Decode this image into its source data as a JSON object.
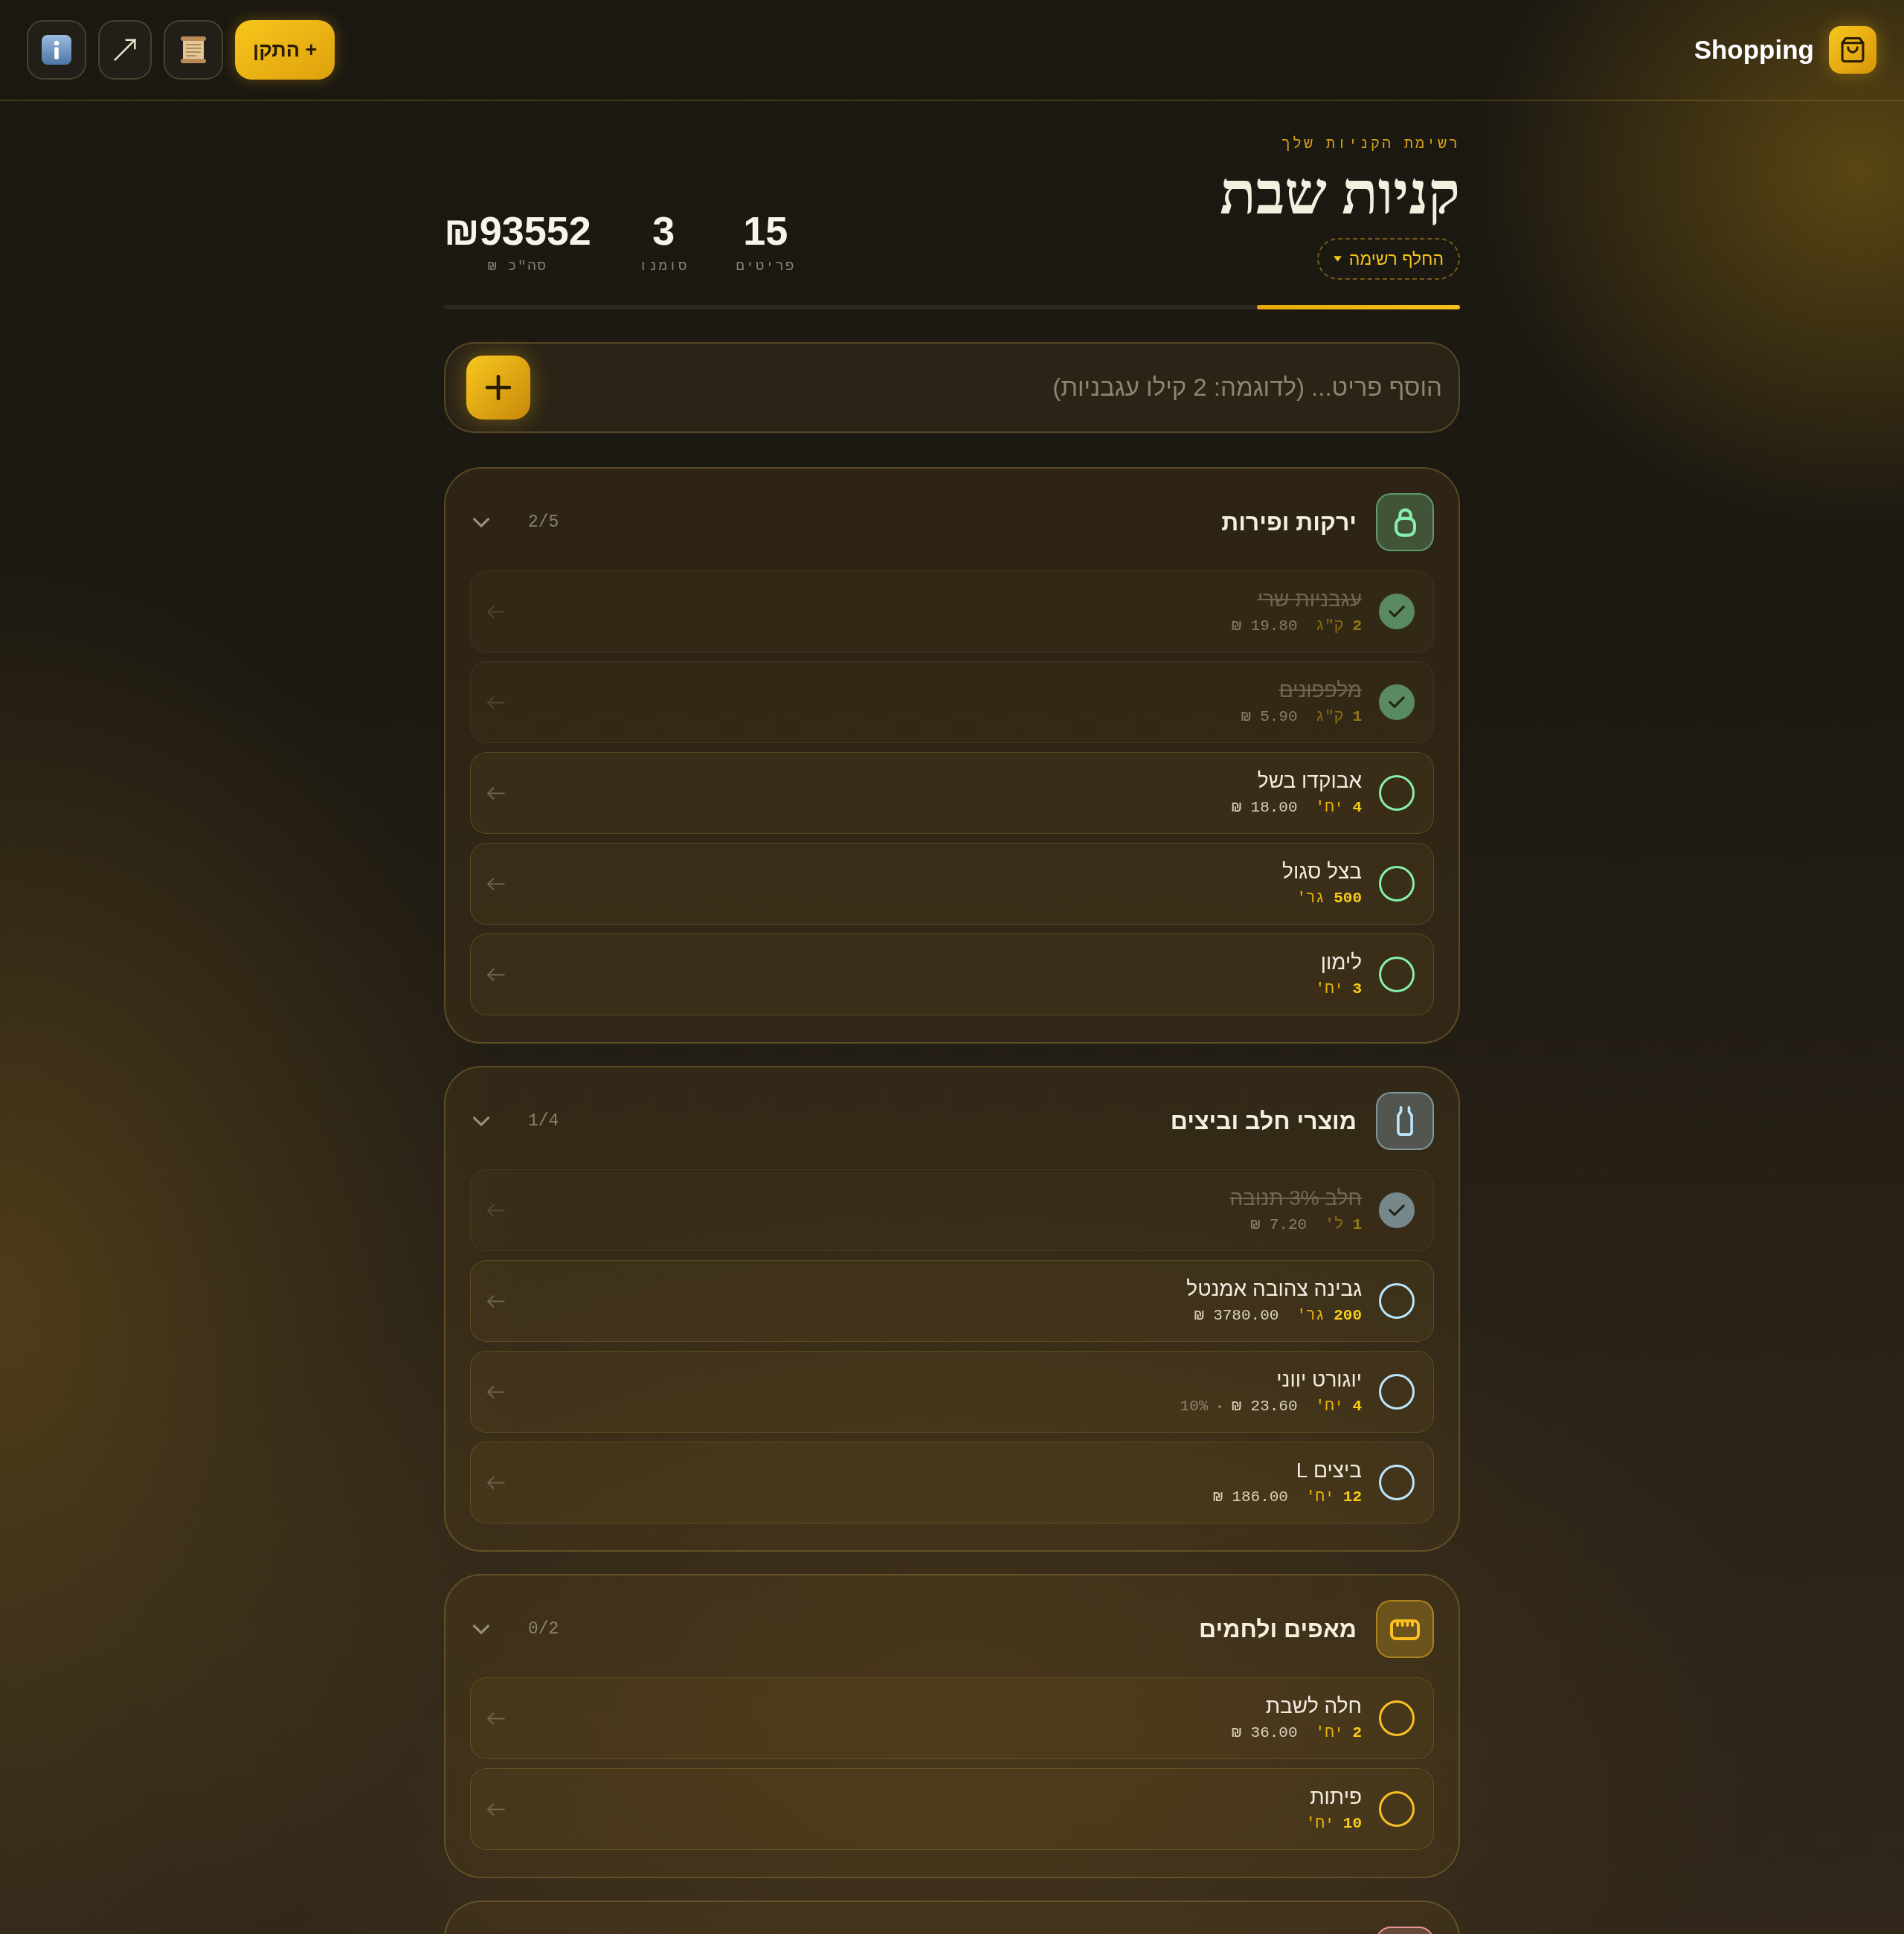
{
  "topbar": {
    "title": "Shopping",
    "install_button": "+ התקן"
  },
  "header": {
    "eyebrow": "רשימת הקניות שלך",
    "title": "קניות שבת",
    "switch_list": "החלף רשימה",
    "stats": [
      {
        "value": "15",
        "label": "פריטים"
      },
      {
        "value": "3",
        "label": "סומנו"
      },
      {
        "value": "₪93552",
        "label": "סה\"כ ₪"
      }
    ],
    "progress": {
      "level": 0.2
    }
  },
  "add_item": {
    "placeholder": "הוסף פריט... (לדוגמה: 2 קילו עגבניות)"
  },
  "categories": [
    {
      "kind": "produce",
      "name": "ירקות ופירות",
      "count": "2/5",
      "expanded": true,
      "color": "#86efac",
      "items": [
        {
          "name": "עגבניות שרי",
          "qty": "2",
          "unit": "ק\"ג",
          "price": "19.80 ₪",
          "checked": true
        },
        {
          "name": "מלפפונים",
          "qty": "1",
          "unit": "ק\"ג",
          "price": "5.90 ₪",
          "checked": true
        },
        {
          "name": "אבוקדו בשל",
          "qty": "4",
          "unit": "יח'",
          "price": "18.00 ₪",
          "checked": false
        },
        {
          "name": "בצל סגול",
          "qty": "500",
          "unit": "גר'",
          "checked": false
        },
        {
          "name": "לימון",
          "qty": "3",
          "unit": "יח'",
          "checked": false
        }
      ]
    },
    {
      "kind": "dairy",
      "name": "מוצרי חלב וביצים",
      "count": "1/4",
      "expanded": true,
      "color": "#bae6fd",
      "items": [
        {
          "name": "חלב 3% תנובה",
          "qty": "1",
          "unit": "ל'",
          "price": "7.20 ₪",
          "checked": true
        },
        {
          "name": "גבינה צהובה אמנטל",
          "qty": "200",
          "unit": "גר'",
          "price": "3780.00 ₪",
          "checked": false
        },
        {
          "name": "יוגורט יווני",
          "qty": "4",
          "unit": "יח'",
          "price": "23.60 ₪",
          "note": "10%",
          "checked": false
        },
        {
          "name": "ביצים L",
          "qty": "12",
          "unit": "יח'",
          "price": "186.00 ₪",
          "checked": false
        }
      ]
    },
    {
      "kind": "bakery",
      "name": "מאפים ולחמים",
      "count": "0/2",
      "expanded": true,
      "color": "#fbbf24",
      "items": [
        {
          "name": "חלה לשבת",
          "qty": "2",
          "unit": "יח'",
          "price": "36.00 ₪",
          "checked": false
        },
        {
          "name": "פיתות",
          "qty": "10",
          "unit": "יח'",
          "checked": false
        }
      ]
    },
    {
      "color": "#e8919a"
    }
  ]
}
